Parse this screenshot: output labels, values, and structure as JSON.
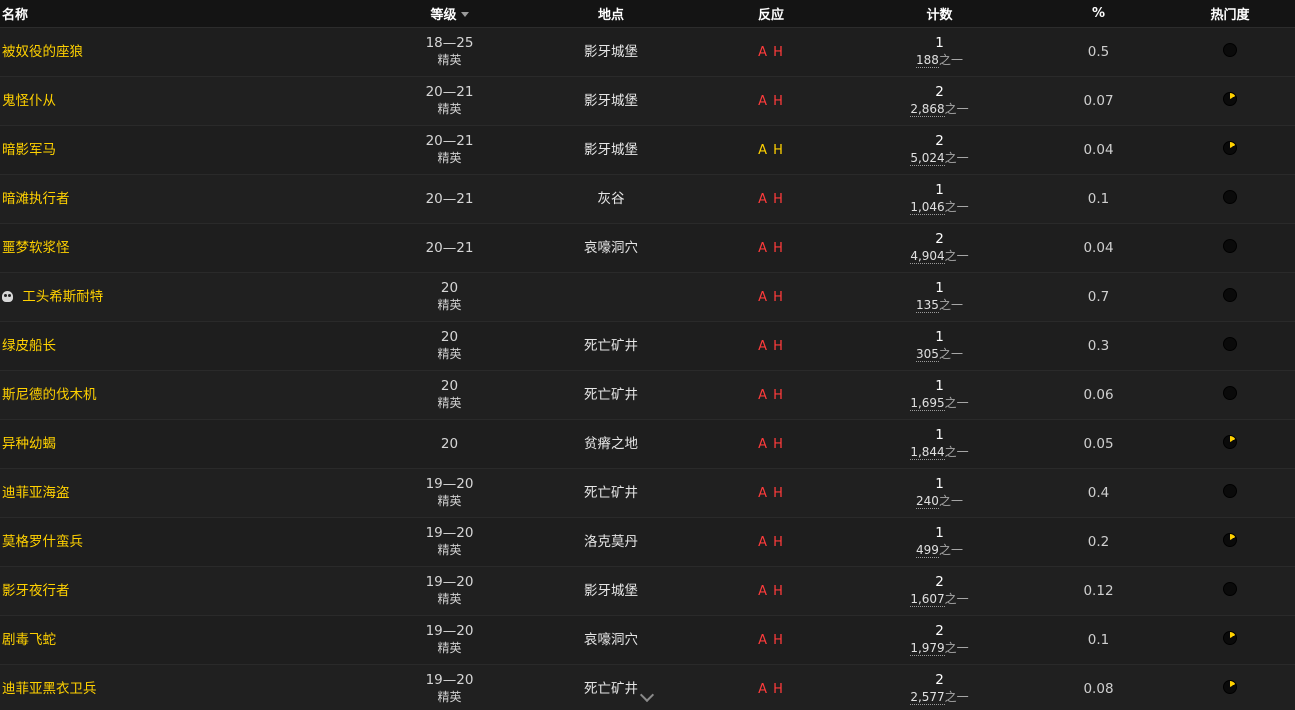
{
  "headers": {
    "name": "名称",
    "level": "等级",
    "location": "地点",
    "react": "反应",
    "count": "计数",
    "pct": "%",
    "popularity": "热门度"
  },
  "rows": [
    {
      "name": "被奴役的座狼",
      "level": "18—25",
      "elite": "精英",
      "location": "影牙城堡",
      "react_a": "A",
      "react_h": "H",
      "react_color": "red",
      "count": "1",
      "of": "188",
      "of_suffix": "之一",
      "pct": "0.5",
      "pop": "dark"
    },
    {
      "name": "鬼怪仆从",
      "level": "20—21",
      "elite": "精英",
      "location": "影牙城堡",
      "react_a": "A",
      "react_h": "H",
      "react_color": "red",
      "count": "2",
      "of": "2,868",
      "of_suffix": "之一",
      "pct": "0.07",
      "pop": "partial"
    },
    {
      "name": "暗影军马",
      "level": "20—21",
      "elite": "精英",
      "location": "影牙城堡",
      "react_a": "A",
      "react_h": "H",
      "react_color": "yellow",
      "count": "2",
      "of": "5,024",
      "of_suffix": "之一",
      "pct": "0.04",
      "pop": "partial"
    },
    {
      "name": "暗滩执行者",
      "level": "20—21",
      "elite": "",
      "location": "灰谷",
      "react_a": "A",
      "react_h": "H",
      "react_color": "red",
      "count": "1",
      "of": "1,046",
      "of_suffix": "之一",
      "pct": "0.1",
      "pop": "dark"
    },
    {
      "name": "噩梦软浆怪",
      "level": "20—21",
      "elite": "",
      "location": "哀嚎洞穴",
      "react_a": "A",
      "react_h": "H",
      "react_color": "red",
      "count": "2",
      "of": "4,904",
      "of_suffix": "之一",
      "pct": "0.04",
      "pop": "dark"
    },
    {
      "name": "工头希斯耐特",
      "boss": true,
      "level": "20",
      "elite": "精英",
      "location": "",
      "react_a": "A",
      "react_h": "H",
      "react_color": "red",
      "count": "1",
      "of": "135",
      "of_suffix": "之一",
      "pct": "0.7",
      "pop": "dark"
    },
    {
      "name": "绿皮船长",
      "level": "20",
      "elite": "精英",
      "location": "死亡矿井",
      "react_a": "A",
      "react_h": "H",
      "react_color": "red",
      "count": "1",
      "of": "305",
      "of_suffix": "之一",
      "pct": "0.3",
      "pop": "dark"
    },
    {
      "name": "斯尼德的伐木机",
      "level": "20",
      "elite": "精英",
      "location": "死亡矿井",
      "react_a": "A",
      "react_h": "H",
      "react_color": "red",
      "count": "1",
      "of": "1,695",
      "of_suffix": "之一",
      "pct": "0.06",
      "pop": "dark"
    },
    {
      "name": "异种幼蝎",
      "level": "20",
      "elite": "",
      "location": "贫瘠之地",
      "react_a": "A",
      "react_h": "H",
      "react_color": "red",
      "count": "1",
      "of": "1,844",
      "of_suffix": "之一",
      "pct": "0.05",
      "pop": "partial"
    },
    {
      "name": "迪菲亚海盗",
      "level": "19—20",
      "elite": "精英",
      "location": "死亡矿井",
      "react_a": "A",
      "react_h": "H",
      "react_color": "red",
      "count": "1",
      "of": "240",
      "of_suffix": "之一",
      "pct": "0.4",
      "pop": "dark"
    },
    {
      "name": "莫格罗什蛮兵",
      "level": "19—20",
      "elite": "精英",
      "location": "洛克莫丹",
      "react_a": "A",
      "react_h": "H",
      "react_color": "red",
      "count": "1",
      "of": "499",
      "of_suffix": "之一",
      "pct": "0.2",
      "pop": "partial"
    },
    {
      "name": "影牙夜行者",
      "level": "19—20",
      "elite": "精英",
      "location": "影牙城堡",
      "react_a": "A",
      "react_h": "H",
      "react_color": "red",
      "count": "2",
      "of": "1,607",
      "of_suffix": "之一",
      "pct": "0.12",
      "pop": "dark"
    },
    {
      "name": "剧毒飞蛇",
      "level": "19—20",
      "elite": "精英",
      "location": "哀嚎洞穴",
      "react_a": "A",
      "react_h": "H",
      "react_color": "red",
      "count": "2",
      "of": "1,979",
      "of_suffix": "之一",
      "pct": "0.1",
      "pop": "partial"
    },
    {
      "name": "迪菲亚黑衣卫兵",
      "level": "19—20",
      "elite": "精英",
      "location": "死亡矿井",
      "react_a": "A",
      "react_h": "H",
      "react_color": "red",
      "count": "2",
      "of": "2,577",
      "of_suffix": "之一",
      "pct": "0.08",
      "pop": "partial"
    }
  ]
}
